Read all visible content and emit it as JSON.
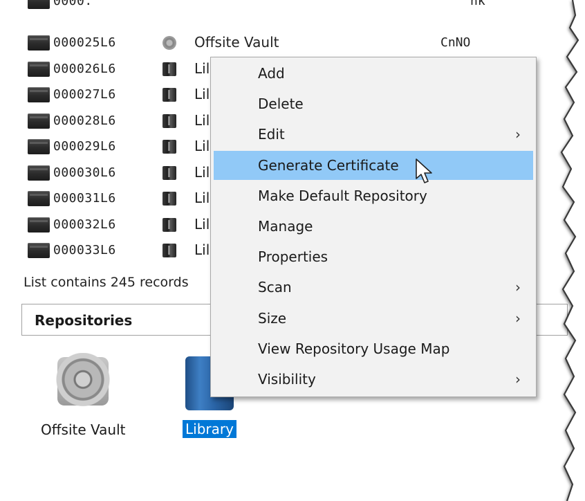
{
  "rows": [
    {
      "barcode": "000025L6",
      "repo_icon": "vault-icon",
      "repo": "Offsite Vault",
      "status": "CnNO"
    },
    {
      "barcode": "000026L6",
      "repo_icon": "library-icon",
      "repo": "Lil",
      "status": ""
    },
    {
      "barcode": "000027L6",
      "repo_icon": "library-icon",
      "repo": "Lil",
      "status": ""
    },
    {
      "barcode": "000028L6",
      "repo_icon": "library-icon",
      "repo": "Lil",
      "status": ""
    },
    {
      "barcode": "000029L6",
      "repo_icon": "library-icon",
      "repo": "Lil",
      "status": ""
    },
    {
      "barcode": "000030L6",
      "repo_icon": "library-icon",
      "repo": "Lil",
      "status": ""
    },
    {
      "barcode": "000031L6",
      "repo_icon": "library-icon",
      "repo": "Lil",
      "status": ""
    },
    {
      "barcode": "000032L6",
      "repo_icon": "library-icon",
      "repo": "Lil",
      "status": ""
    },
    {
      "barcode": "000033L6",
      "repo_icon": "library-icon",
      "repo": "Lil",
      "status": ""
    }
  ],
  "partial_top_row": {
    "barcode": "0000.",
    "status": "nk"
  },
  "list_status": "List contains 245 records",
  "repositories_header": "Repositories",
  "repositories": [
    {
      "label": "Offsite Vault",
      "icon": "vault-icon",
      "selected": false
    },
    {
      "label": "Library",
      "icon": "library-icon",
      "selected": true
    }
  ],
  "context_menu": [
    {
      "label": "Add",
      "submenu": false,
      "highlighted": false
    },
    {
      "label": "Delete",
      "submenu": false,
      "highlighted": false
    },
    {
      "label": "Edit",
      "submenu": true,
      "highlighted": false
    },
    {
      "label": "Generate Certificate",
      "submenu": false,
      "highlighted": true
    },
    {
      "label": "Make Default Repository",
      "submenu": false,
      "highlighted": false
    },
    {
      "label": "Manage",
      "submenu": false,
      "highlighted": false
    },
    {
      "label": "Properties",
      "submenu": false,
      "highlighted": false
    },
    {
      "label": "Scan",
      "submenu": true,
      "highlighted": false
    },
    {
      "label": "Size",
      "submenu": true,
      "highlighted": false
    },
    {
      "label": "View Repository Usage Map",
      "submenu": false,
      "highlighted": false
    },
    {
      "label": "Visibility",
      "submenu": true,
      "highlighted": false
    }
  ],
  "submenu_arrow": "›",
  "colors": {
    "highlight": "#91c9f7",
    "selection": "#0078d7",
    "menu_bg": "#f2f2f2"
  }
}
